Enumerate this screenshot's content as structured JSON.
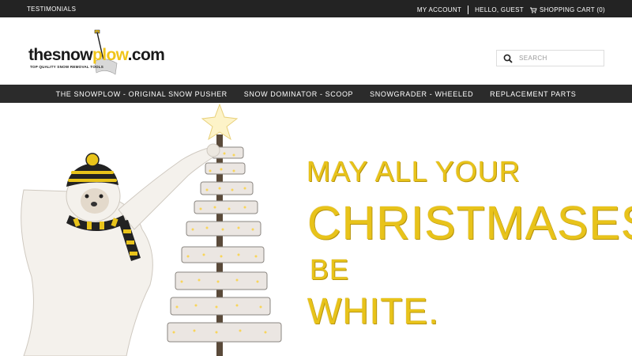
{
  "topbar": {
    "testimonials": "TESTIMONIALS",
    "my_account": "MY ACCOUNT",
    "hello": "HELLO, GUEST",
    "cart": "SHOPPING CART (0)"
  },
  "header": {
    "logo": {
      "word_the": "the",
      "word_snow": "snow",
      "word_plow": "plow",
      "word_com": ".com",
      "tagline": "TOP QUALITY SNOW REMOVAL TOOLS"
    },
    "search": {
      "placeholder": "SEARCH",
      "value": ""
    }
  },
  "nav": {
    "items": [
      {
        "label": "THE SNOWPLOW - ORIGINAL SNOW PUSHER"
      },
      {
        "label": "SNOW DOMINATOR - SCOOP"
      },
      {
        "label": "SNOWGRADER - WHEELED"
      },
      {
        "label": "REPLACEMENT PARTS"
      }
    ]
  },
  "hero": {
    "line1": "MAY ALL YOUR",
    "line2": "CHRISTMASES",
    "line3": "BE",
    "line4": "WHITE."
  },
  "colors": {
    "topbar": "#232323",
    "nav": "#2b2b2b",
    "gold": "#e8c31a",
    "logo_yellow": "#f0c419"
  }
}
